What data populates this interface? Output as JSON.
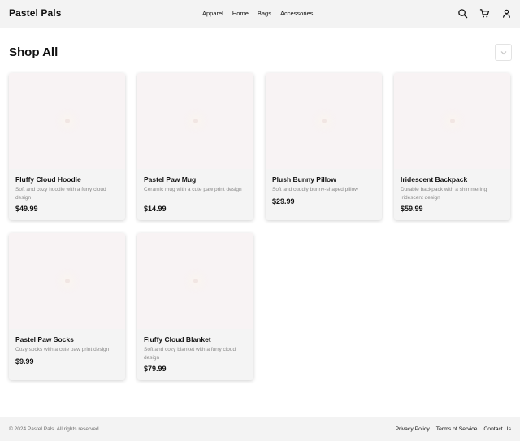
{
  "header": {
    "brand": "Pastel Pals",
    "nav": [
      {
        "label": "Apparel"
      },
      {
        "label": "Home"
      },
      {
        "label": "Bags"
      },
      {
        "label": "Accessories"
      }
    ],
    "icons": [
      "search-icon",
      "cart-icon",
      "user-icon"
    ]
  },
  "main": {
    "title": "Shop All",
    "sort_icon": "chevron-down-icon",
    "products": [
      {
        "title": "Fluffy Cloud Hoodie",
        "description": "Soft and cozy hoodie with a furry cloud design",
        "price": "$49.99"
      },
      {
        "title": "Pastel Paw Mug",
        "description": "Ceramic mug with a cute paw print design",
        "price": "$14.99"
      },
      {
        "title": "Plush Bunny Pillow",
        "description": "Soft and cuddly bunny-shaped pillow",
        "price": "$29.99"
      },
      {
        "title": "Iridescent Backpack",
        "description": "Durable backpack with a shimmering iridescent design",
        "price": "$59.99"
      },
      {
        "title": "Pastel Paw Socks",
        "description": "Cozy socks with a cute paw print design",
        "price": "$9.99"
      },
      {
        "title": "Fluffy Cloud Blanket",
        "description": "Soft and cozy blanket with a furry cloud design",
        "price": "$79.99"
      }
    ]
  },
  "footer": {
    "copyright": "© 2024 Pastel Pals. All rights reserved.",
    "links": [
      {
        "label": "Privacy Policy"
      },
      {
        "label": "Terms of Service"
      },
      {
        "label": "Contact Us"
      }
    ]
  },
  "colors": {
    "header_bg": "#f3f3f3",
    "card_bg": "#f4f4f4",
    "image_placeholder": "#f8f3f4"
  }
}
